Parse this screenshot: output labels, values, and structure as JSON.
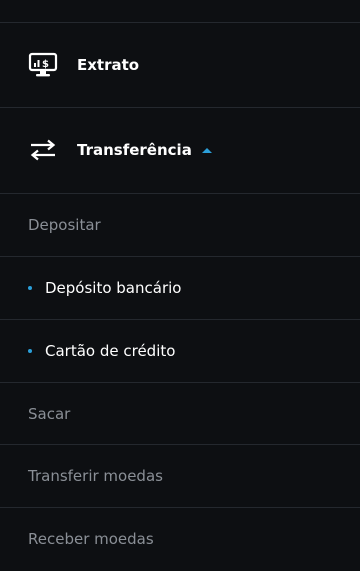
{
  "menu": {
    "extrato": {
      "label": "Extrato",
      "icon": "monitor-dollar-icon"
    },
    "transferencia": {
      "label": "Transferência",
      "icon": "transfer-arrows-icon",
      "expanded": true,
      "items": [
        {
          "label": "Depositar",
          "active": false
        },
        {
          "label": "Depósito bancário",
          "active": true
        },
        {
          "label": "Cartão de crédito",
          "active": true
        },
        {
          "label": "Sacar",
          "active": false
        },
        {
          "label": "Transferir moedas",
          "active": false
        },
        {
          "label": "Receber moedas",
          "active": false
        }
      ]
    }
  },
  "colors": {
    "background": "#0d0f12",
    "separator": "#24282e",
    "accent": "#2b9fd9",
    "muted_text": "#8a8f96",
    "text": "#ffffff"
  }
}
